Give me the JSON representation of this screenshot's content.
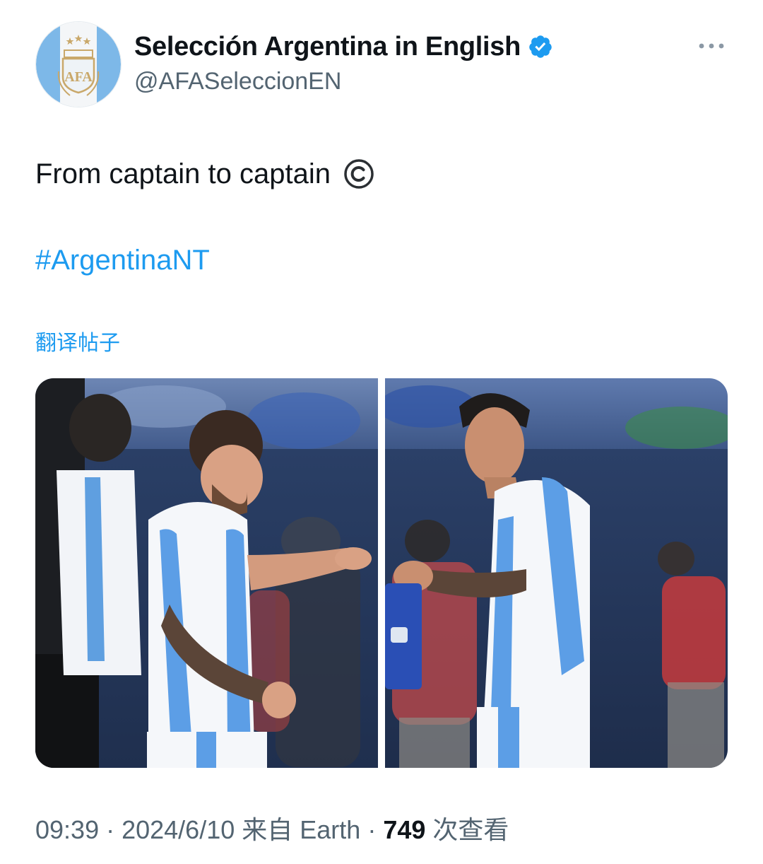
{
  "author": {
    "display_name": "Selección Argentina in English",
    "handle": "@AFASeleccionEN",
    "verified": true,
    "avatar_icon": "afa-crest-icon"
  },
  "tweet": {
    "text": "From captain to captain",
    "emoji_icon": "copyright-icon",
    "hashtag": "#ArgentinaNT",
    "translate_label": "翻译帖子"
  },
  "media": {
    "photos": [
      {
        "icon": "photo-captain-handing-armband"
      },
      {
        "icon": "photo-captain-receiving-armband"
      }
    ]
  },
  "meta": {
    "time": "09:39",
    "sep1": " · ",
    "date": "2024/6/10",
    "source_prefix": " 来自 ",
    "source": "Earth",
    "sep2": " · ",
    "views": "749",
    "views_label": " 次查看"
  },
  "colors": {
    "accent": "#1d9bf0",
    "secondary_text": "#536471",
    "primary_text": "#0f1419",
    "argentina_sky_blue": "#6cace4"
  }
}
